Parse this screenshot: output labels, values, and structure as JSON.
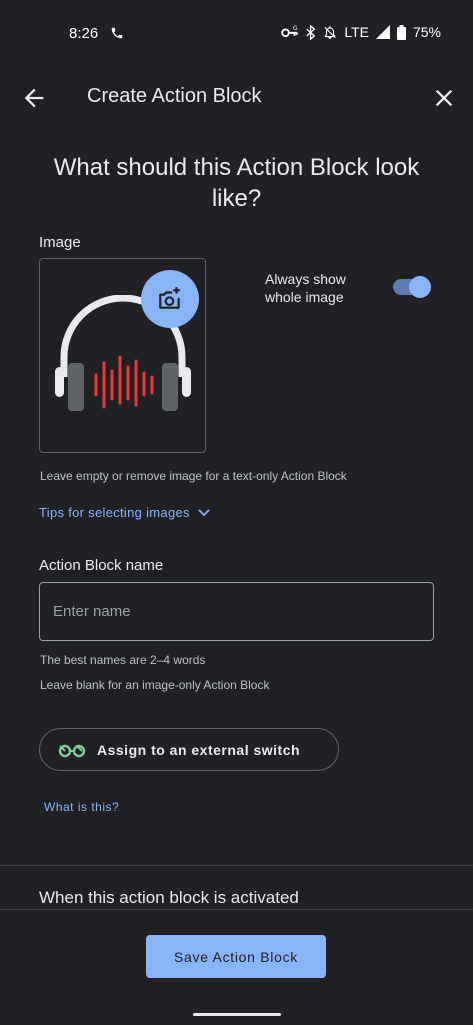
{
  "status_bar": {
    "time": "8:26",
    "network": "LTE",
    "battery": "75%",
    "icons": [
      "phone-call-icon",
      "vpn-key-icon",
      "bluetooth-icon",
      "do-not-disturb-icon",
      "signal-icon",
      "battery-icon"
    ]
  },
  "app_bar": {
    "title": "Create Action Block",
    "back_icon": "arrow-back-icon",
    "close_icon": "close-icon"
  },
  "question": "What should this Action Block look like?",
  "image_section": {
    "label": "Image",
    "toggle_label": "Always show whole image",
    "toggle_on": true,
    "hint": "Leave empty or remove image for a text-only Action Block",
    "tips_link": "Tips for selecting images"
  },
  "name_section": {
    "label": "Action Block name",
    "placeholder": "Enter name",
    "value": "",
    "hint1": "The best names are 2–4 words",
    "hint2": "Leave blank for an image-only Action Block"
  },
  "switch_button": {
    "label": "Assign to an external switch"
  },
  "what_link": "What is this?",
  "activated_heading": "When this action block is activated",
  "save_button": "Save Action Block",
  "colors": {
    "background": "#202124",
    "accent": "#8ab4f8",
    "text": "#e8eaed",
    "waveform": "#e53935",
    "switch_icon": "#81c995"
  }
}
